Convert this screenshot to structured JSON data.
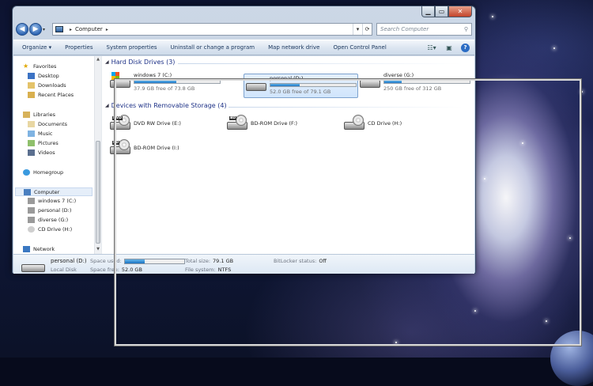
{
  "window": {
    "caption": {
      "minimize": "▁",
      "maximize": "▭",
      "close": "✕"
    }
  },
  "address_bar": {
    "path": [
      "Computer"
    ],
    "search_placeholder": "Search Computer"
  },
  "toolbar": {
    "items": [
      "Organize ▾",
      "Properties",
      "System properties",
      "Uninstall or change a program",
      "Map network drive",
      "Open Control Panel"
    ]
  },
  "nav_pane": {
    "favorites": {
      "label": "Favorites",
      "items": [
        "Desktop",
        "Downloads",
        "Recent Places"
      ]
    },
    "libraries": {
      "label": "Libraries",
      "items": [
        "Documents",
        "Music",
        "Pictures",
        "Videos"
      ]
    },
    "homegroup": "Homegroup",
    "computer": {
      "label": "Computer",
      "items": [
        "windows 7 (C:)",
        "personal (D:)",
        "diverse (G:)",
        "CD Drive (H:)"
      ]
    },
    "network": "Network"
  },
  "groups": {
    "hard_disks": {
      "header": "Hard Disk Drives (3)",
      "drives": [
        {
          "name": "windows 7 (C:)",
          "free": "37.9 GB free of 73.8 GB",
          "used_fraction": 0.49
        },
        {
          "name": "personal (D:)",
          "free": "52.0 GB free of 79.1 GB",
          "used_fraction": 0.34
        },
        {
          "name": "diverse (G:)",
          "free": "250 GB free of 312 GB",
          "used_fraction": 0.2
        }
      ]
    },
    "removable": {
      "header": "Devices with Removable Storage (4)",
      "drives": [
        {
          "name": "DVD RW Drive (E:)",
          "tag": "DVD"
        },
        {
          "name": "BD-ROM Drive (F:)",
          "tag": "BD"
        },
        {
          "name": "CD Drive (H:)",
          "tag": ""
        },
        {
          "name": "BD-ROM Drive (I:)",
          "tag": "BD"
        }
      ]
    }
  },
  "details": {
    "name": "personal (D:)",
    "type": "Local Disk",
    "space_used_label": "Space used:",
    "space_used_fraction": 0.34,
    "space_free_label": "Space free:",
    "space_free": "52.0 GB",
    "total_size_label": "Total size:",
    "total_size": "79.1 GB",
    "file_system_label": "File system:",
    "file_system": "NTFS",
    "bitlocker_label": "BitLocker status:",
    "bitlocker": "Off"
  }
}
